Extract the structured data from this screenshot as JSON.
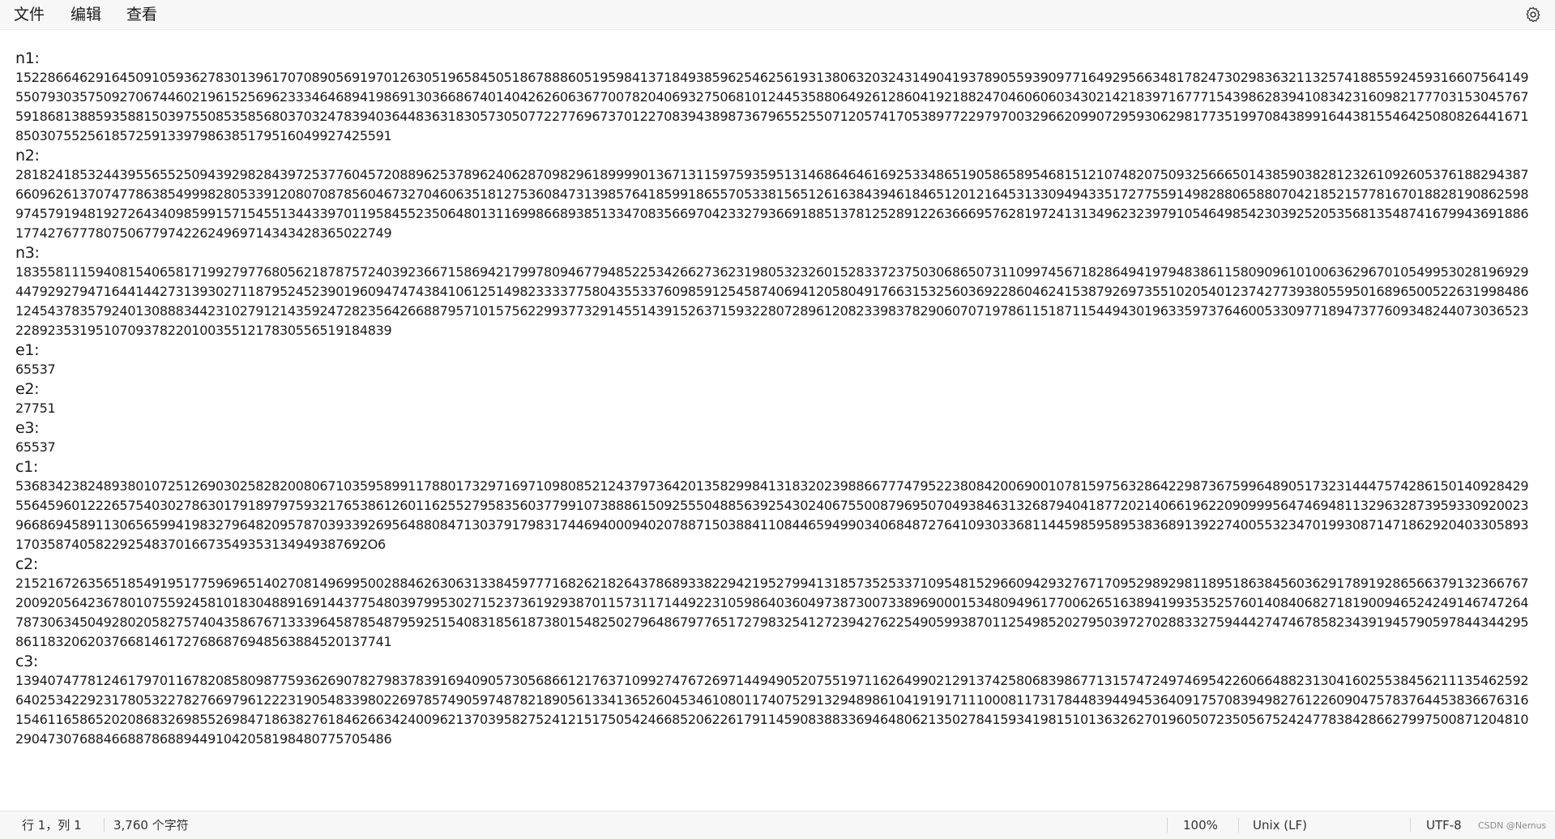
{
  "menu": {
    "file": "文件",
    "edit": "编辑",
    "view": "查看"
  },
  "editor": {
    "lines": [
      {
        "kind": "label",
        "text": "n1:"
      },
      {
        "kind": "value",
        "text": "152286646291645091059362783013961707089056919701263051965845051867888605195984137184938596254625619313806320324314904193789055939097716492956634817824730298363211325741885592459316607564149"
      },
      {
        "kind": "value",
        "text": "550793035750927067446021961525696233346468941986913036686740140426260636770078204069327506810124453588064926128604192188247046060603430214218397167771543986283941083423160982177703153045767"
      },
      {
        "kind": "value",
        "text": "591868138859358815039755085358568037032478394036448363183057305077227769673701227083943898736796552550712057417053897722979700329662099072959306298177351997084389916443815546425080826441671"
      },
      {
        "kind": "value",
        "text": "85030755256185725913397986385179516049927425591"
      },
      {
        "kind": "label",
        "text": "n2:"
      },
      {
        "kind": "value",
        "text": "281824185324439556552509439298284397253776045720889625378962406287098296189999013671311597593595131468646461692533486519058658954681512107482075093256665014385903828123261092605376188294387"
      },
      {
        "kind": "value",
        "text": "660962613707477863854999828053391208070878560467327046063518127536084731398576418599186557053381565126163843946184651201216453133094943351727755914982880658807042185215778167018828190862598"
      },
      {
        "kind": "value",
        "text": "974579194819272643409859915715455134433970119584552350648013116998668938513347083566970423327936691885137812528912263666957628197241313496232397910546498542303925205356813548741679943691886"
      },
      {
        "kind": "value",
        "text": "17742767778075067797422624969714343428365022749"
      },
      {
        "kind": "label",
        "text": "n3:"
      },
      {
        "kind": "value",
        "text": "183558111594081540658171992797768056218787572403923667158694217997809467794852253426627362319805323260152833723750306865073110997456718286494197948386115809096101006362967010549953028196929"
      },
      {
        "kind": "value",
        "text": "447929279471644144273139302711879524523901960947474384106125149823333775804355337609859125458740694120580491766315325603692286046241538792697355102054012374277393805595016896500522631998486"
      },
      {
        "kind": "value",
        "text": "124543783579240130888344231027912143592472823564266887957101575622993773291455143915263715932280728961208233983782906070719786115187115449430196335973764600533097718947377609348244073036523"
      },
      {
        "kind": "value",
        "text": "22892353195107093782201003551217830556519184839"
      },
      {
        "kind": "label",
        "text": "e1:"
      },
      {
        "kind": "value",
        "text": "65537"
      },
      {
        "kind": "label",
        "text": "e2:"
      },
      {
        "kind": "value",
        "text": "27751"
      },
      {
        "kind": "label",
        "text": "e3:"
      },
      {
        "kind": "value",
        "text": "65537"
      },
      {
        "kind": "label",
        "text": "c1:"
      },
      {
        "kind": "value",
        "text": "536834238248938010725126903025828200806710359589911788017329716971098085212437973642013582998413183202398866777479522380842006900107815975632864229873675996489051732314447574286150140928429"
      },
      {
        "kind": "value",
        "text": "556459601222657540302786301791897975932176538612601162552795835603779910738886150925550488563925430240675500879695070493846313268794041877202140661962209099956474694811329632873959330920023"
      },
      {
        "kind": "value",
        "text": "966869458911306565994198327964820957870393392695648808471303791798317446940009402078871503884110844659499034068487276410930336811445985958953836891392274005532347019930871471862920403305893"
      },
      {
        "kind": "value",
        "text": "17035874058229254837016673549353134949387692O6"
      },
      {
        "kind": "label",
        "text": "c2:"
      },
      {
        "kind": "value",
        "text": "215216726356518549195177596965140270814969950028846263063133845977716826218264378689338229421952799413185735253371095481529660942932767170952989298118951863845603629178919286566379132366767"
      },
      {
        "kind": "value",
        "text": "200920564236780107559245810183048891691443775480397995302715237361929387011573117144922310598640360497387300733896900015348094961770062651638941993535257601408406827181900946524249146747264"
      },
      {
        "kind": "value",
        "text": "787306345049280205827574043586767133396458785487959251540831856187380154825027964867977651727983254127239427622549059938701125498520279503972702883327594442747467858234391945790597844344295"
      },
      {
        "kind": "value",
        "text": "86118320620376681461727686876948563884520137741"
      },
      {
        "kind": "label",
        "text": "c3:"
      },
      {
        "kind": "value",
        "text": "139407477812461797011678208580987759362690782798378391694090573056866121763710992747672697144949052075519711626499021291374258068398677131574724974695422606648823130416025538456211135462592"
      },
      {
        "kind": "value",
        "text": "640253422923178053227827669796122231905483398022697857490597487821890561334136526045346108011740752913294898610419191711100081173178448394494536409175708394982761226090475783764453836676316"
      },
      {
        "kind": "value",
        "text": "154611658652020868326985526984718638276184626634240096213703958275241215175054246685206226179114590838833694648062135027841593419815101363262701960507235056752424778384286627997500871204810"
      },
      {
        "kind": "value",
        "text": "29047307688466887868894491042058198480775705486"
      }
    ]
  },
  "status": {
    "position": "行 1，列 1",
    "char_count": "3,760 个字符",
    "zoom": "100%",
    "line_ending": "Unix (LF)",
    "encoding": "UTF-8",
    "watermark": "CSDN @Nemus"
  },
  "icons": {
    "settings": "gear-icon"
  }
}
